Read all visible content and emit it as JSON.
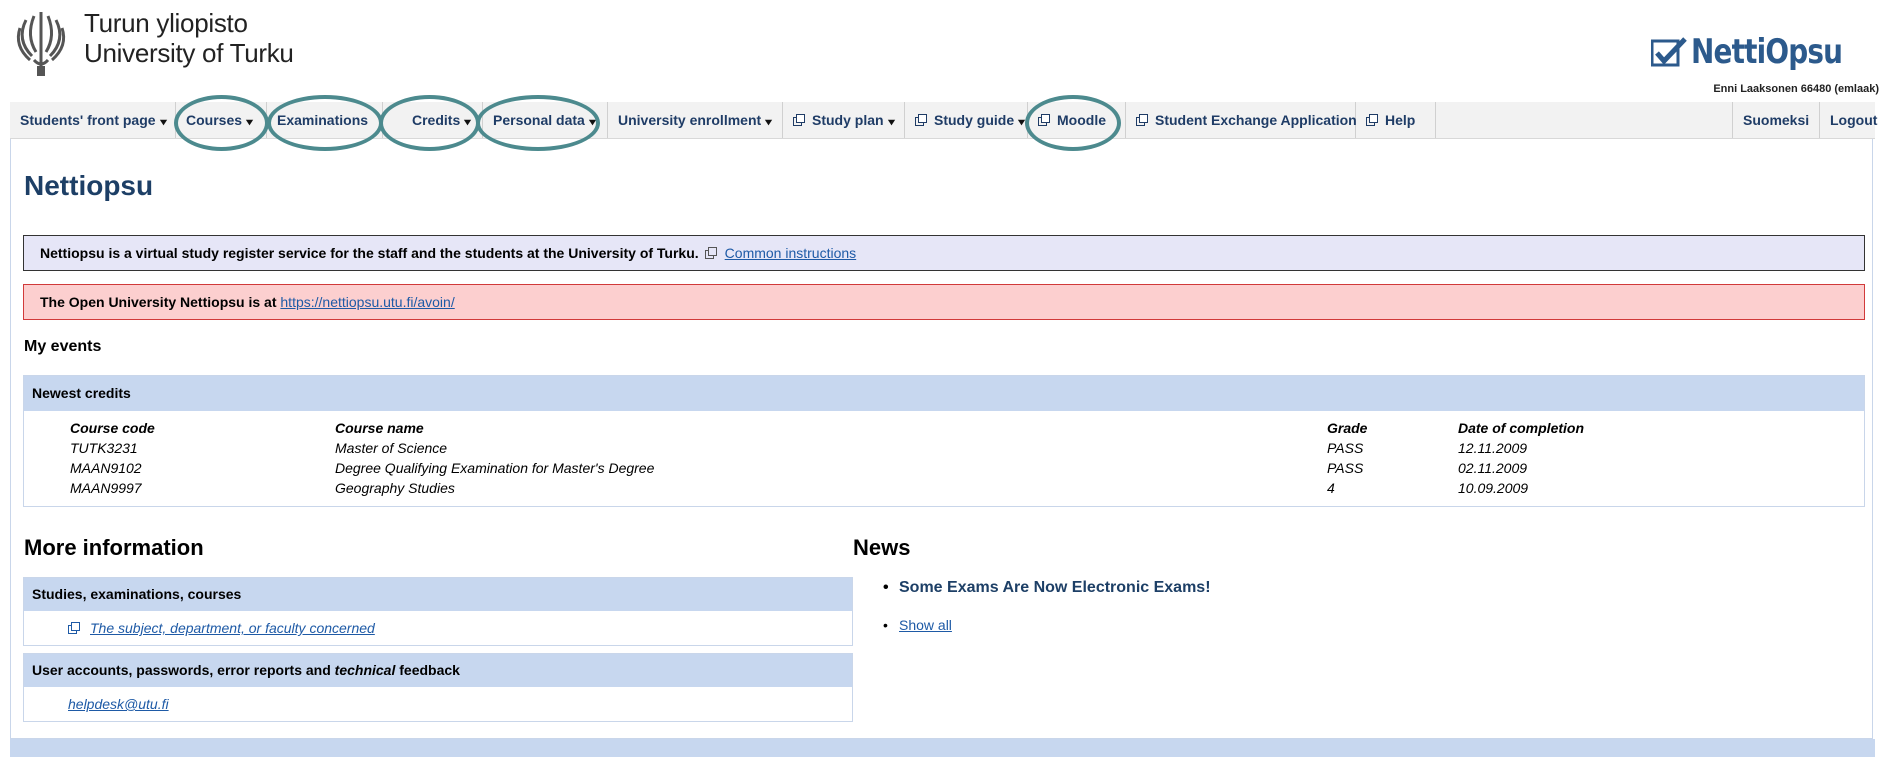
{
  "header": {
    "uni_name_fi": "Turun yliopisto",
    "uni_name_en": "University of Turku",
    "brand": "NettiOpsu",
    "user": "Enni Laaksonen 66480 (emlaak)"
  },
  "nav": {
    "items": [
      {
        "label": "Students' front page"
      },
      {
        "label": "Courses"
      },
      {
        "label": "Examinations"
      },
      {
        "label": "Credits"
      },
      {
        "label": "Personal data"
      },
      {
        "label": "University enrollment"
      },
      {
        "label": "Study plan"
      },
      {
        "label": "Study guide"
      },
      {
        "label": "Moodle"
      },
      {
        "label": "Student Exchange Application"
      },
      {
        "label": "Help"
      }
    ],
    "language": "Suomeksi",
    "logout": "Logout"
  },
  "page": {
    "title": "Nettiopsu",
    "notice_info": "Nettiopsu is a virtual study register service for the staff and the students at the University of Turku.",
    "notice_info_link": "Common instructions",
    "notice_open": "The Open University Nettiopsu is at",
    "notice_open_link": "https://nettiopsu.utu.fi/avoin/"
  },
  "events": {
    "title": "My events",
    "panel_title": "Newest credits",
    "columns": [
      "Course code",
      "Course name",
      "Grade",
      "Date of completion"
    ],
    "rows": [
      {
        "code": "TUTK3231",
        "name": "Master of Science",
        "grade": "PASS",
        "date": "12.11.2009"
      },
      {
        "code": "MAAN9102",
        "name": "Degree Qualifying Examination for Master's Degree",
        "grade": "PASS",
        "date": "02.11.2009"
      },
      {
        "code": "MAAN9997",
        "name": "Geography Studies",
        "grade": "4",
        "date": "10.09.2009"
      }
    ]
  },
  "more_info": {
    "title": "More information",
    "panel1_title": "Studies, examinations, courses",
    "panel1_link": "The subject, department, or faculty concerned",
    "panel2_title_a": "User accounts, passwords, error reports and",
    "panel2_title_em": "technical",
    "panel2_title_b": "feedback",
    "panel2_link": "helpdesk@utu.fi"
  },
  "news": {
    "title": "News",
    "items": [
      "Some Exams Are Now Electronic Exams!"
    ],
    "show_all": "Show all"
  },
  "colors": {
    "nav_text": "#1f3c66",
    "annotation_circle": "#4c8a8e",
    "panel_header": "#c7d7ef",
    "info_notice": "#e6e6f7",
    "alert_notice": "#fccfcf",
    "brand": "#2c5a8c"
  }
}
